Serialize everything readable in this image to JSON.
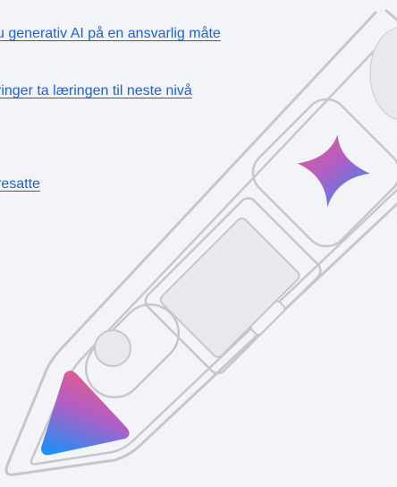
{
  "links": [
    {
      "label": "u generativ AI på en ansvarlig måte"
    },
    {
      "label": "ringer ta læringen til neste nivå"
    },
    {
      "label": "resatte"
    }
  ],
  "illustration": {
    "pen_icon": "pen-icon",
    "star_icon": "sparkle-star-icon",
    "device_icon": "laptop-icon",
    "tip_icon": "triangle-icon",
    "gradient_colors": [
      "#e85a8a",
      "#b25ec4",
      "#1f8ff5"
    ],
    "outline_color": "#c5c7cc",
    "fill_color": "#e8e9ec"
  }
}
